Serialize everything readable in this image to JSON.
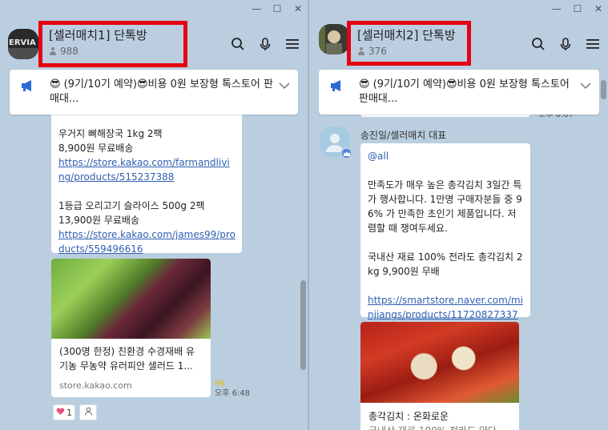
{
  "left": {
    "title": "[셀러매치1] 단톡방",
    "member_count": "988",
    "avatar_text": "ERVIA",
    "notice": "😎 (9기/10기 예약)😎비용 0원 보장형 톡스토어 판매대...",
    "message": {
      "item1_name": "우거지 뼈해장국 1kg 2팩",
      "item1_price": "8,900원 무료배송",
      "item1_link": "https://store.kakao.com/farmandliving/products/515237388",
      "item2_name": "1등급 오리고기 슬라이스 500g 2팩",
      "item2_price": "13,900원 무료배송",
      "item2_link": "https://store.kakao.com/james99/products/559496616"
    },
    "card": {
      "desc": "(300명 한정) 친환경 수경재배 유기농 무농약 유러피안 샐러드 1...",
      "domain": "store.kakao.com"
    },
    "unread": "99",
    "time": "오후 6:48",
    "reaction_count": "1"
  },
  "right": {
    "title": "[셀러매치2] 단톡방",
    "member_count": "376",
    "notice": "😎 (9기/10기 예약)😎비용 0원 보장형 톡스토어 판매대...",
    "prev_time": "오후 6:07",
    "sender": "송진일/셀러매치 대표",
    "message": {
      "mention": "@all",
      "body1": "만족도가 매우 높은 총각김치 3일간 특가 행사합니다. 1만명 구매자분들 중 96% 가 만족한 초인기 제품입니다. 저렴할 때 쟁여두세요.",
      "body2": "국내산 재료 100% 전라도 총각김치 2kg 9,900원 무배",
      "link": "https://smartstore.naver.com/minjjangs/products/11720827337"
    },
    "card": {
      "desc": "총각김치 : 온화로운",
      "desc2": "국내산 재료 100% 전라도 양다"
    }
  },
  "colors": {
    "chat_bg": "#bacee0",
    "highlight": "#e60012",
    "link": "#2f5fb3",
    "unread": "#e8b800"
  }
}
